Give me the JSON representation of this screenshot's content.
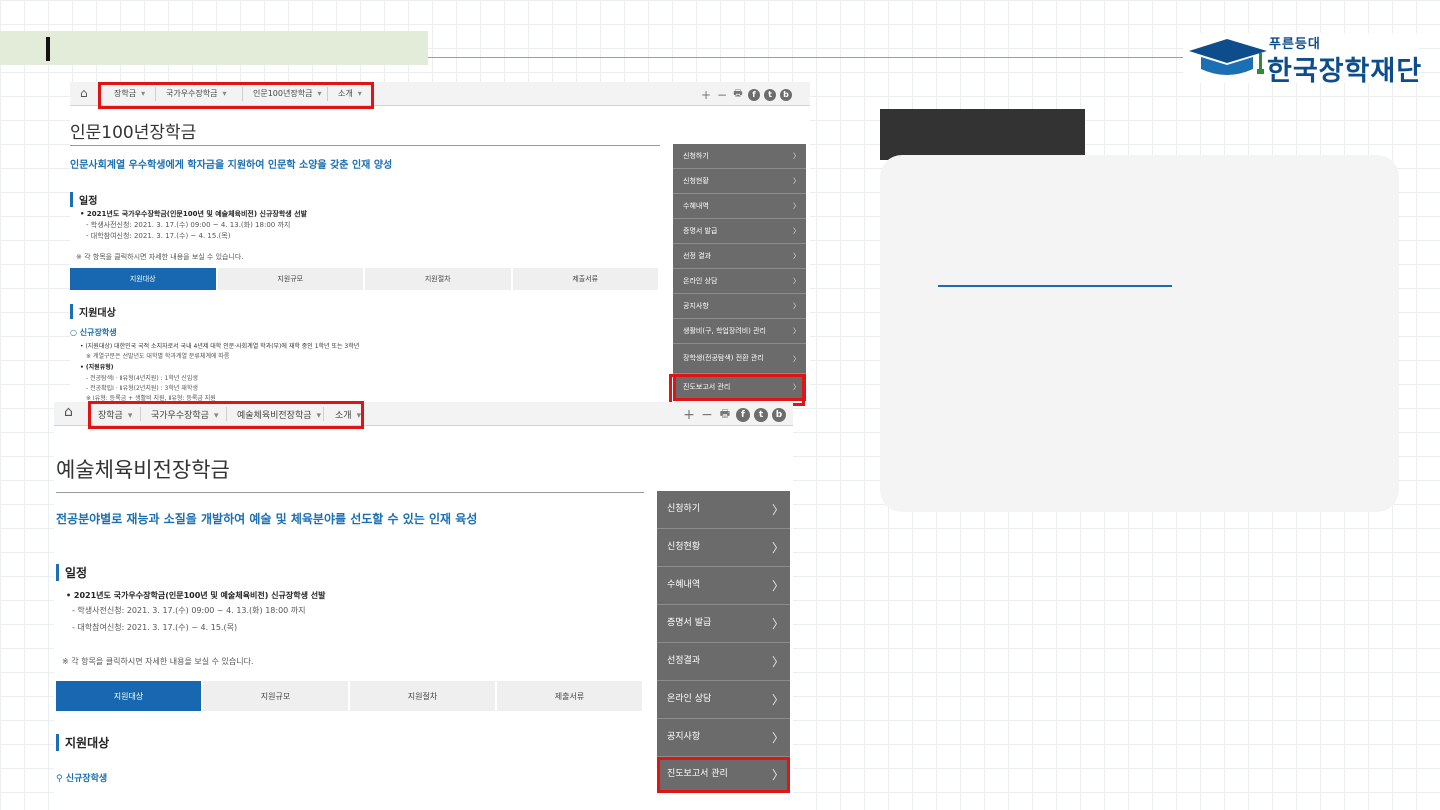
{
  "logo": {
    "small": "푸른등대",
    "big": "한국장학재단"
  },
  "shot1": {
    "menu": [
      "장학금",
      "국가우수장학금",
      "인문100년장학금",
      "소개"
    ],
    "tools": {
      "plus": "+",
      "minus": "−",
      "print": "🖶",
      "facebook": "f",
      "twitter": "t",
      "blog": "b"
    },
    "title": "인문100년장학금",
    "subtitle": "인문사회계열 우수학생에게 학자금을 지원하여 인문학 소양을 갖춘 인재 양성",
    "schedule_head": "일정",
    "schedule_main": "• 2021년도 국가우수장학금(인문100년 및 예술체육비전) 신규장학생 선발",
    "schedule_1": "- 학생사전신청: 2021. 3. 17.(수) 09:00 ~ 4. 13.(화) 18:00 까지",
    "schedule_2": "- 대학참여신청: 2021. 3. 17.(수) ~ 4. 15.(목)",
    "note": "※ 각 항목을 클릭하시면 자세한 내용을 보실 수 있습니다.",
    "tabs": [
      "지원대상",
      "지원규모",
      "지원절차",
      "제출서류"
    ],
    "target_head": "지원대상",
    "new_scholar": "신규장학생",
    "t1": "• (지원대상) 대한민국 국적 소지자로서 국내 4년제 대학 인문·사회계열 학과(부)에 재학 중인 1학년 또는 3학년",
    "t2": "※ 계열구분은 선발년도 대학별 학과계열 분류체계에 따름",
    "t3": "• (지원유형)",
    "t4": "- 전공탐색Ⅰ · Ⅱ유형(4년지원) : 1학년 신입생",
    "t5": "- 전공확립Ⅰ · Ⅱ유형(2년지원) : 3학년 재학생",
    "t6": "※ Ⅰ유형: 등록금 + 생활비 지원, Ⅱ유형: 등록금 지원",
    "side": [
      "신청하기",
      "신청현황",
      "수혜내역",
      "증명서 발급",
      "선정 결과",
      "온라인 상담",
      "공지사항",
      "생활비(구, 학업장려비) 관리",
      "장학생(전공탐색) 전환 관리",
      "진도보고서 관리"
    ]
  },
  "shot2": {
    "menu": [
      "장학금",
      "국가우수장학금",
      "예술체육비전장학금",
      "소개"
    ],
    "tools": {
      "plus": "+",
      "minus": "−",
      "print": "🖶",
      "facebook": "f",
      "twitter": "t",
      "blog": "b"
    },
    "title": "예술체육비전장학금",
    "subtitle": "전공분야별로 재능과 소질을 개발하여 예술 및 체육분야를 선도할 수 있는 인재 육성",
    "schedule_head": "일정",
    "schedule_main": "• 2021년도 국가우수장학금(인문100년 및 예술체육비전) 신규장학생 선발",
    "schedule_1": "- 학생사전신청: 2021. 3. 17.(수) 09:00 ~ 4. 13.(화) 18:00 까지",
    "schedule_2": "- 대학참여신청: 2021. 3. 17.(수) ~ 4. 15.(목)",
    "note": "※ 각 항목을 클릭하시면 자세한 내용을 보실 수 있습니다.",
    "tabs": [
      "지원대상",
      "지원규모",
      "지원절차",
      "제출서류"
    ],
    "target_head": "지원대상",
    "new_scholar": "신규장학생",
    "side": [
      "신청하기",
      "신청현황",
      "수혜내역",
      "증명서 발급",
      "선정결과",
      "온라인 상담",
      "공지사항",
      "진도보고서 관리"
    ]
  }
}
